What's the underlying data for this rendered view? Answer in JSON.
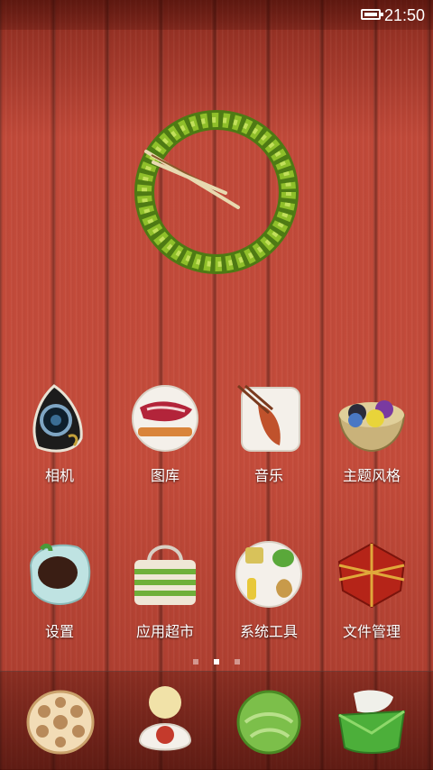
{
  "status_bar": {
    "time": "21:50",
    "battery_icon": "battery-full-icon"
  },
  "clock_widget": {
    "icon": "wheat-wreath-clock-icon"
  },
  "apps_row1": [
    {
      "label": "相机",
      "icon": "camera-eye-icon"
    },
    {
      "label": "图库",
      "icon": "gallery-meat-plate-icon"
    },
    {
      "label": "音乐",
      "icon": "music-fish-plate-icon"
    },
    {
      "label": "主题风格",
      "icon": "theme-bowl-icon"
    }
  ],
  "apps_row2": [
    {
      "label": "设置",
      "icon": "settings-dish-icon"
    },
    {
      "label": "应用超市",
      "icon": "market-basket-icon"
    },
    {
      "label": "系统工具",
      "icon": "tools-plate-icon"
    },
    {
      "label": "文件管理",
      "icon": "file-gift-box-icon"
    }
  ],
  "pager": {
    "pages": 3,
    "active_index": 1
  },
  "dock": [
    {
      "icon": "lotus-root-icon"
    },
    {
      "icon": "baby-figure-icon"
    },
    {
      "icon": "cabbage-icon"
    },
    {
      "icon": "green-cup-icon"
    }
  ]
}
